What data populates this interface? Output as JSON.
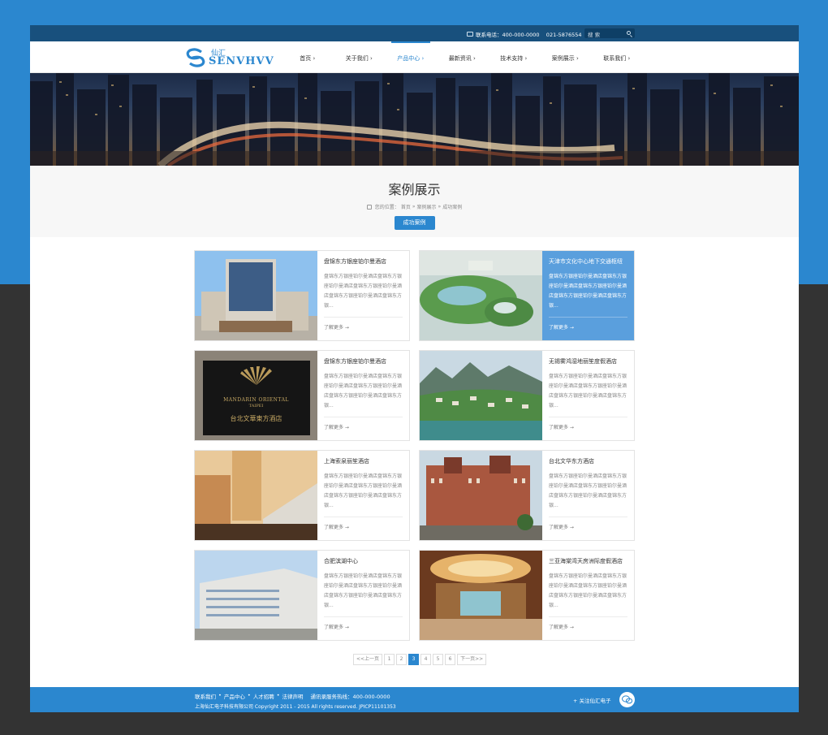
{
  "topbar": {
    "contact": "联系电话：400-000-0000    021-5876554",
    "search_placeholder": "搜 索"
  },
  "brand": {
    "cn": "仙汇",
    "en": "SENVHVV"
  },
  "nav": [
    "首页 ›",
    "关于我们 ›",
    "产品中心 ›",
    "最新资讯 ›",
    "技术支持 ›",
    "案例展示 ›",
    "联系我们 ›"
  ],
  "hero": {
    "title": "案例展示",
    "crumb": [
      "您的位置：",
      "首页",
      "»",
      "案例展示",
      "»",
      "成功案例"
    ],
    "tag": "成功案例"
  },
  "cards": [
    {
      "title": "盘锦东方银座铂尔曼酒店",
      "desc": "盘锦东方银座铂尔曼酒店盘锦东方银座铂尔曼酒店盘锦东方银座铂尔曼酒店盘锦东方银座铂尔曼酒店盘锦东方银...",
      "more": "了解更多 →"
    },
    {
      "title": "天津市文化中心地下交通枢纽",
      "desc": "盘锦东方银座铂尔曼酒店盘锦东方银座铂尔曼酒店盘锦东方银座铂尔曼酒店盘锦东方银座铂尔曼酒店盘锦东方银...",
      "more": "了解更多 →"
    },
    {
      "title": "盘锦东方银座铂尔曼酒店",
      "desc": "盘锦东方银座铂尔曼酒店盘锦东方银座铂尔曼酒店盘锦东方银座铂尔曼酒店盘锦东方银座铂尔曼酒店盘锦东方银...",
      "more": "了解更多 →"
    },
    {
      "title": "无锡雾鸿湿地丽笙度假酒店",
      "desc": "盘锦东方银座铂尔曼酒店盘锦东方银座铂尔曼酒店盘锦东方银座铂尔曼酒店盘锦东方银座铂尔曼酒店盘锦东方银...",
      "more": "了解更多 →"
    },
    {
      "title": "上海索泉丽笙酒店",
      "desc": "盘锦东方银座铂尔曼酒店盘锦东方银座铂尔曼酒店盘锦东方银座铂尔曼酒店盘锦东方银座铂尔曼酒店盘锦东方银...",
      "more": "了解更多 →"
    },
    {
      "title": "台北文华东方酒店",
      "desc": "盘锦东方银座铂尔曼酒店盘锦东方银座铂尔曼酒店盘锦东方银座铂尔曼酒店盘锦东方银座铂尔曼酒店盘锦东方银...",
      "more": "了解更多 →"
    },
    {
      "title": "合肥滨湖中心",
      "desc": "盘锦东方银座铂尔曼酒店盘锦东方银座铂尔曼酒店盘锦东方银座铂尔曼酒店盘锦东方银座铂尔曼酒店盘锦东方银...",
      "more": "了解更多 →"
    },
    {
      "title": "三亚海棠湾天房洲际度假酒店",
      "desc": "盘锦东方银座铂尔曼酒店盘锦东方银座铂尔曼酒店盘锦东方银座铂尔曼酒店盘锦东方银座铂尔曼酒店盘锦东方银...",
      "more": "了解更多 →"
    }
  ],
  "mandarin": {
    "en1": "MANDARIN ORIENTAL",
    "en2": "TAIPEI",
    "cn": "台北文華東方酒店"
  },
  "pager": [
    "<<上一页",
    "1",
    "2",
    "3",
    "4",
    "5",
    "6",
    "下一页>>"
  ],
  "pager_active": "3",
  "footer": {
    "links": [
      "联系我们",
      "•",
      "产品中心",
      "•",
      "人才招聘",
      "•",
      "法律声明",
      "通讯录服务热线：400-000-0000"
    ],
    "copyright": "上海仙汇电子科技有限公司 Copyright 2011 - 2015 All rights reserved. JPICP11101353",
    "follow": "+ 关注仙汇电子"
  },
  "colors": {
    "brand": "#2b87cf",
    "topbar": "#18507d",
    "highlight": "#5a9fdd",
    "dark_bg": "#333333"
  }
}
